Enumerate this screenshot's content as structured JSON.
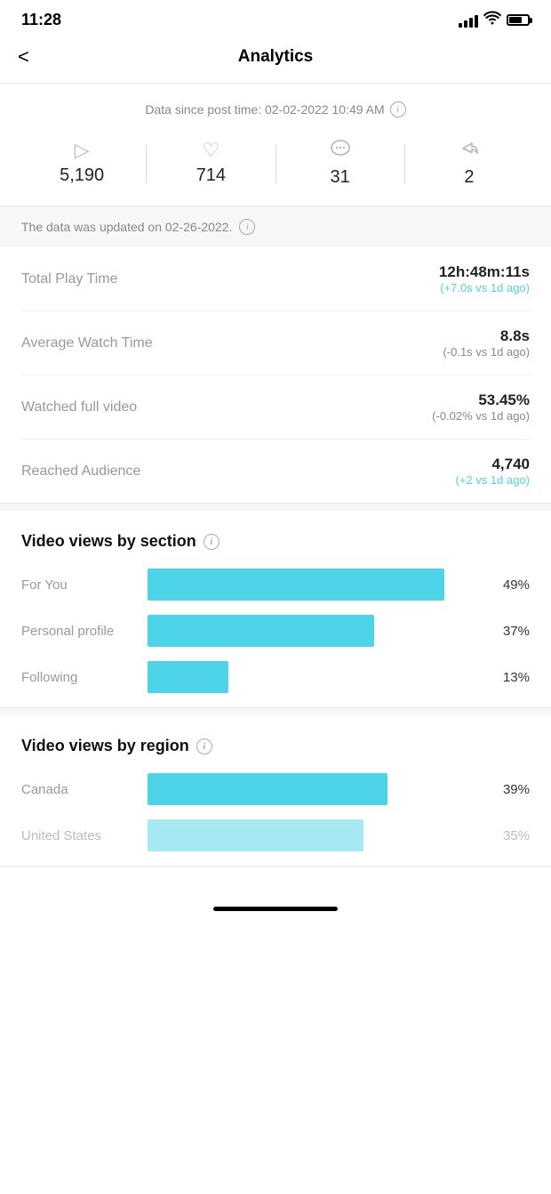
{
  "statusBar": {
    "time": "11:28"
  },
  "header": {
    "backLabel": "<",
    "title": "Analytics"
  },
  "dataSince": {
    "text": "Data since post time: 02-02-2022 10:49 AM",
    "infoIcon": "i"
  },
  "stats": [
    {
      "id": "plays",
      "icon": "▷",
      "value": "5,190"
    },
    {
      "id": "likes",
      "icon": "♡",
      "value": "714"
    },
    {
      "id": "comments",
      "icon": "⊙",
      "value": "31"
    },
    {
      "id": "shares",
      "icon": "↪",
      "value": "2"
    }
  ],
  "updateNotice": {
    "text": "The data was updated on 02-26-2022.",
    "infoIcon": "i"
  },
  "metrics": [
    {
      "label": "Total Play Time",
      "value": "12h:48m:11s",
      "change": "(+7.0s vs 1d ago)",
      "changeType": "positive"
    },
    {
      "label": "Average Watch Time",
      "value": "8.8s",
      "change": "(-0.1s vs 1d ago)",
      "changeType": "negative"
    },
    {
      "label": "Watched full video",
      "value": "53.45%",
      "change": "(-0.02% vs 1d ago)",
      "changeType": "negative"
    },
    {
      "label": "Reached Audience",
      "value": "4,740",
      "change": "(+2 vs 1d ago)",
      "changeType": "positive"
    }
  ],
  "viewsBySection": {
    "title": "Video views by section",
    "infoIcon": "i",
    "bars": [
      {
        "label": "For You",
        "percent": 49,
        "displayPercent": "49%"
      },
      {
        "label": "Personal profile",
        "percent": 37,
        "displayPercent": "37%"
      },
      {
        "label": "Following",
        "percent": 13,
        "displayPercent": "13%"
      }
    ]
  },
  "viewsByRegion": {
    "title": "Video views by region",
    "infoIcon": "i",
    "bars": [
      {
        "label": "Canada",
        "percent": 39,
        "displayPercent": "39%"
      },
      {
        "label": "United States",
        "percent": 35,
        "displayPercent": "35%"
      }
    ]
  }
}
